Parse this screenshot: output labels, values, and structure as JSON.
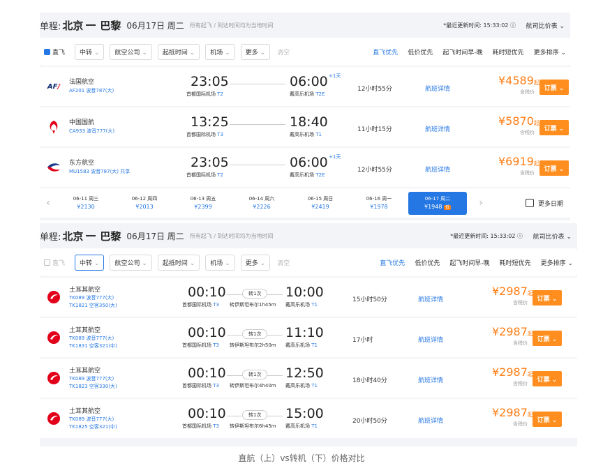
{
  "direct": {
    "header": {
      "label": "单程:",
      "from": "北京",
      "to": "巴黎",
      "date": "06月17日 周二",
      "note": "所有起飞 / 到达时间均为当地时间",
      "update": "*最近更新时间: 15:33:02 ⓘ",
      "compare": "航司比价表 ⌄"
    },
    "filters": {
      "direct_label": "直飞",
      "dropdowns": [
        "中转",
        "航空公司",
        "起抵时间",
        "机场",
        "更多"
      ],
      "clear": "清空",
      "sorts": [
        "直飞优先",
        "低价优先",
        "起飞时间早-晚",
        "耗时短优先",
        "更多排序 ⌄"
      ]
    },
    "flights": [
      {
        "airline": "法国航空",
        "flight": "AF201 波音787(大)",
        "dep": "23:05",
        "dep_ap": "首都国际机场",
        "dep_t": "T2",
        "arr": "06:00",
        "arr_ap": "戴高乐机场",
        "arr_t": "T2E",
        "plus": "+1天",
        "dur": "12小时55分",
        "detail": "航班详情",
        "price": "¥4589",
        "qi": "起",
        "tax": "含税价",
        "book": "订票 ⌄"
      },
      {
        "airline": "中国国航",
        "flight": "CA933 波音777(大)",
        "dep": "13:25",
        "dep_ap": "首都国际机场",
        "dep_t": "T3",
        "arr": "18:40",
        "arr_ap": "戴高乐机场",
        "arr_t": "T1",
        "plus": "",
        "dur": "11小时15分",
        "detail": "航班详情",
        "price": "¥5870",
        "qi": "起",
        "tax": "含税价",
        "book": "订票 ⌄"
      },
      {
        "airline": "东方航空",
        "flight": "MU1583 波音787(大) 共享",
        "dep": "23:05",
        "dep_ap": "首都国际机场",
        "dep_t": "T2",
        "arr": "06:00",
        "arr_ap": "戴高乐机场",
        "arr_t": "T2E",
        "plus": "+1天",
        "dur": "12小时55分",
        "detail": "航班详情",
        "price": "¥6919",
        "qi": "起",
        "tax": "含税价",
        "book": "订票 ⌄"
      }
    ],
    "dates": [
      {
        "d": "06-11 周三",
        "p": "¥2130"
      },
      {
        "d": "06-12 周四",
        "p": "¥2013"
      },
      {
        "d": "06-13 周五",
        "p": "¥2399"
      },
      {
        "d": "06-14 周六",
        "p": "¥2226"
      },
      {
        "d": "06-15 周日",
        "p": "¥2419"
      },
      {
        "d": "06-16 周一",
        "p": "¥1978"
      },
      {
        "d": "06-17 周二",
        "p": "¥1948",
        "low": "低"
      }
    ],
    "more_dates": "更多日期"
  },
  "transfer": {
    "header": {
      "label": "单程:",
      "from": "北京",
      "to": "巴黎",
      "date": "06月17日 周二",
      "note": "所有起飞 / 到达时间均为当地时间",
      "update": "*最近更新时间: 15:33:02 ⓘ",
      "compare": "航司比价表 ⌄"
    },
    "filters": {
      "direct_label": "直飞",
      "dropdowns": [
        "中转",
        "航空公司",
        "起抵时间",
        "机场",
        "更多"
      ],
      "clear": "清空",
      "sorts": [
        "直飞优先",
        "低价优先",
        "起飞时间早-晚",
        "耗时短优先",
        "更多排序 ⌄"
      ]
    },
    "flights": [
      {
        "airline": "土耳其航空",
        "f1": "TK089 波音777(大)",
        "f2": "TK1821 空客350(大)",
        "dep": "00:10",
        "dep_ap": "首都国际机场",
        "dep_t": "T3",
        "stop": "转1次",
        "via": "转伊斯坦布尔1h45m",
        "arr": "10:00",
        "arr_ap": "戴高乐机场",
        "arr_t": "T1",
        "dur": "15小时50分",
        "detail": "航班详情",
        "price": "¥2987",
        "qi": "起",
        "tax": "含税价",
        "book": "订票 ⌄"
      },
      {
        "airline": "土耳其航空",
        "f1": "TK089 波音777(大)",
        "f2": "TK1831 空客321(中)",
        "dep": "00:10",
        "dep_ap": "首都国际机场",
        "dep_t": "T3",
        "stop": "转1次",
        "via": "转伊斯坦布尔2h50m",
        "arr": "11:10",
        "arr_ap": "戴高乐机场",
        "arr_t": "T1",
        "dur": "17小时",
        "detail": "航班详情",
        "price": "¥2987",
        "qi": "起",
        "tax": "含税价",
        "book": "订票 ⌄"
      },
      {
        "airline": "土耳其航空",
        "f1": "TK089 波音777(大)",
        "f2": "TK1823 空客330(大)",
        "dep": "00:10",
        "dep_ap": "首都国际机场",
        "dep_t": "T3",
        "stop": "转1次",
        "via": "转伊斯坦布尔4h40m",
        "arr": "12:50",
        "arr_ap": "戴高乐机场",
        "arr_t": "T1",
        "dur": "18小时40分",
        "detail": "航班详情",
        "price": "¥2987",
        "qi": "起",
        "tax": "含税价",
        "book": "订票 ⌄"
      },
      {
        "airline": "土耳其航空",
        "f1": "TK089 波音777(大)",
        "f2": "TK1825 空客321(中)",
        "dep": "00:10",
        "dep_ap": "首都国际机场",
        "dep_t": "T3",
        "stop": "转1次",
        "via": "转伊斯坦布尔6h45m",
        "arr": "15:00",
        "arr_ap": "戴高乐机场",
        "arr_t": "T1",
        "dur": "20小时50分",
        "detail": "航班详情",
        "price": "¥2987",
        "qi": "起",
        "tax": "含税价",
        "book": "订票 ⌄"
      }
    ]
  },
  "caption": "直航（上）vs转机（下）价格对比",
  "colors": {
    "accent": "#2577e3",
    "price": "#ff7d13",
    "book": "#ff8e1e"
  }
}
